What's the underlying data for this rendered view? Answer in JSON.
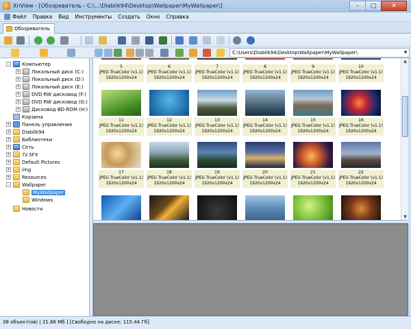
{
  "window": {
    "title": "XnView - [Обозреватель - C:\\...\\Diablik94\\Desktop\\Wallpaper\\MyWallpaper\\]"
  },
  "menu": [
    "Файл",
    "Правка",
    "Вид",
    "Инструменты",
    "Создать",
    "Окно",
    "Справка"
  ],
  "tab": {
    "label": "Обозреватель"
  },
  "path": {
    "value": "C:\\Users\\Diablik94\\Desktop\\Wallpaper\\MyWallpaper\\"
  },
  "tree": [
    {
      "label": "Компьютер",
      "icon": "computer-icon"
    },
    {
      "label": "Локальный диск (C:)",
      "icon": "drive-icon"
    },
    {
      "label": "Локальный диск (D:)",
      "icon": "drive-icon"
    },
    {
      "label": "Локальный диск (E:)",
      "icon": "drive-icon"
    },
    {
      "label": "DVD RW дисковод (F:)",
      "icon": "dvd-icon"
    },
    {
      "label": "DVD RW дисковод (G:)",
      "icon": "dvd-icon"
    },
    {
      "label": "Дисковод BD-ROM (H:)",
      "icon": "dvd-icon"
    },
    {
      "label": "Корзина",
      "icon": "recycle-bin-icon"
    },
    {
      "label": "Панель управления",
      "icon": "control-panel-icon"
    },
    {
      "label": "Diablik94",
      "icon": "user-folder-icon"
    },
    {
      "label": "Библиотеки",
      "icon": "libraries-icon"
    },
    {
      "label": "Сеть",
      "icon": "network-icon"
    },
    {
      "label": "7z.SFX",
      "icon": "folder-icon"
    },
    {
      "label": "Default Pictures",
      "icon": "folder-icon"
    },
    {
      "label": "img",
      "icon": "folder-icon"
    },
    {
      "label": "Resources",
      "icon": "folder-icon"
    },
    {
      "label": "Wallpaper",
      "icon": "folder-icon"
    },
    {
      "label": "MyWallpaper",
      "icon": "folder-icon"
    },
    {
      "label": "Windows",
      "icon": "folder-icon"
    },
    {
      "label": "Новости",
      "icon": "folder-icon"
    }
  ],
  "thumbnails": {
    "format_label": "JPEG TrueColor (v1.1)",
    "resolution": "1920x1200x24",
    "rows": [
      [
        "5",
        "6",
        "7",
        "8",
        "9",
        "10"
      ],
      [
        "11",
        "12",
        "13",
        "14",
        "15",
        "16"
      ],
      [
        "17",
        "18",
        "19",
        "20",
        "21",
        "22"
      ]
    ]
  },
  "status": {
    "text": "38 объект(ов) | 21.66 Мб ] [Свободно на диске: 115.44 Гб]"
  },
  "colors": {
    "accent": "#3d8ee6",
    "caption_bg": "#f0f0d2",
    "preview_bg": "#8c8c8c"
  }
}
